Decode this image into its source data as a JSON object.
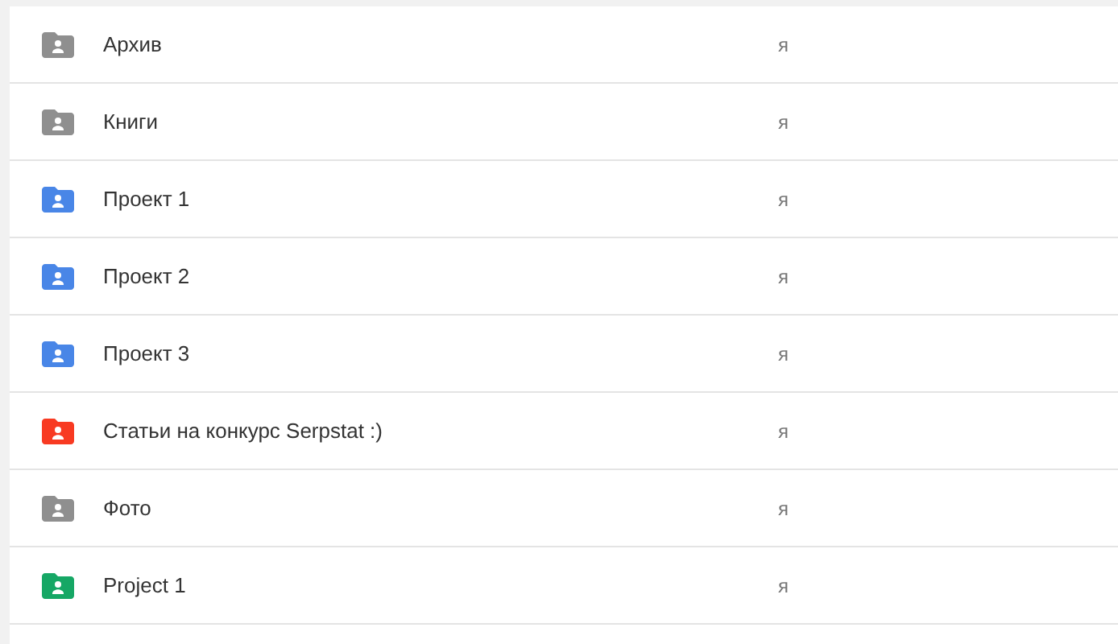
{
  "files": [
    {
      "name": "Архив",
      "owner": "я",
      "color": "#8f8f8f"
    },
    {
      "name": "Книги",
      "owner": "я",
      "color": "#8f8f8f"
    },
    {
      "name": "Проект 1",
      "owner": "я",
      "color": "#4986e7"
    },
    {
      "name": "Проект 2",
      "owner": "я",
      "color": "#4986e7"
    },
    {
      "name": "Проект 3",
      "owner": "я",
      "color": "#4986e7"
    },
    {
      "name": "Статьи на конкурс Serpstat :)",
      "owner": "я",
      "color": "#f83a22"
    },
    {
      "name": "Фото",
      "owner": "я",
      "color": "#8f8f8f"
    },
    {
      "name": "Project 1",
      "owner": "я",
      "color": "#16a765"
    }
  ]
}
